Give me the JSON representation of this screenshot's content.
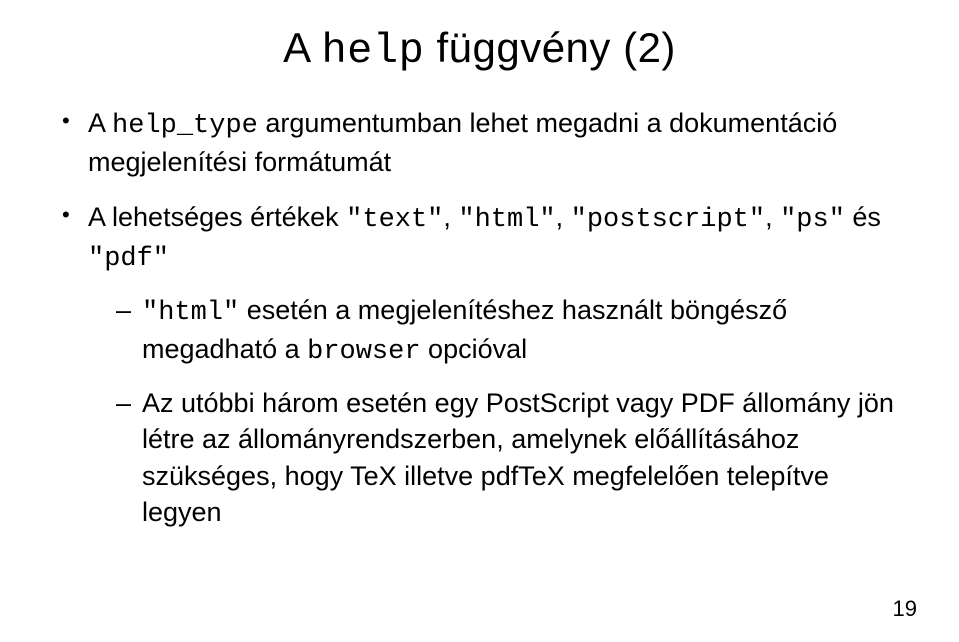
{
  "title": {
    "prefix": "A ",
    "mono": "help",
    "suffix": " függvény (2)"
  },
  "bullets": {
    "b1": {
      "t1": "A ",
      "mono1": "help_type",
      "t2": " argumentumban lehet megadni a dokumentáció megjelenítési formátumát"
    },
    "b2": {
      "t1": "A lehetséges értékek ",
      "mono1": "\"text\"",
      "t2": ", ",
      "mono2": "\"html\"",
      "t3": ", ",
      "mono3": "\"postscript\"",
      "t4": ", ",
      "mono4": "\"ps\"",
      "t5": " és ",
      "mono5": "\"pdf\""
    },
    "b2_1": {
      "mono1": "\"html\"",
      "t1": " esetén a megjelenítéshez használt böngésző megadható a ",
      "mono2": "browser",
      "t2": " opcióval"
    },
    "b2_2": {
      "t1": "Az utóbbi három esetén egy PostScript vagy PDF állomány jön létre az állományrendszerben, amelynek előállításához szükséges, hogy TeX illetve pdfTeX megfelelően telepítve legyen"
    }
  },
  "page_number": "19"
}
